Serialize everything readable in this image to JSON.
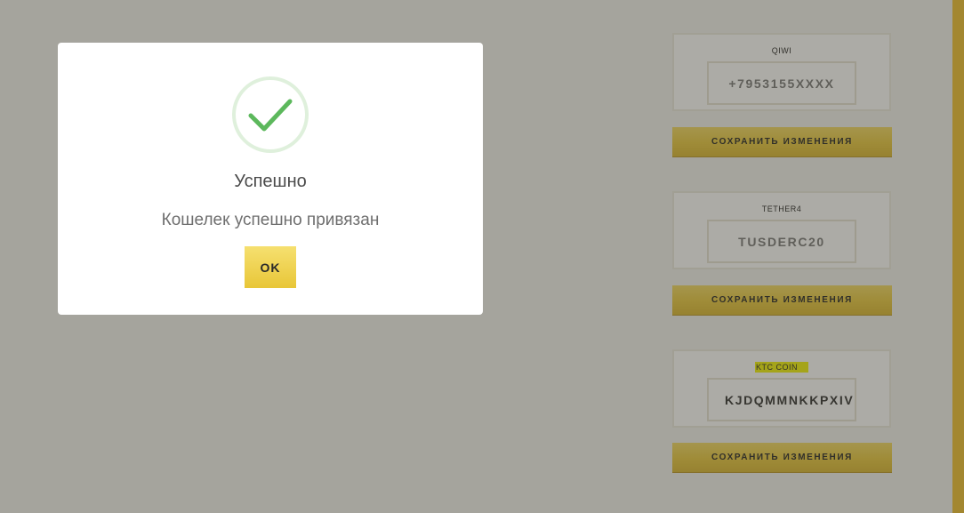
{
  "wallets": [
    {
      "name": "QIWI",
      "placeholder": "+7953155XXXX",
      "value": "",
      "highlighted": false
    },
    {
      "name": "TETHER4",
      "placeholder": "TUSDERC20",
      "value": "",
      "highlighted": false
    },
    {
      "name": "KTC COIN",
      "placeholder": "",
      "value": "KJDQMMNKKPXIV",
      "highlighted": true
    }
  ],
  "save_button_label": "СОХРАНИТЬ ИЗМЕНЕНИЯ",
  "modal": {
    "icon": "checkmark-icon",
    "title": "Успешно",
    "text": "Кошелек успешно привязан",
    "ok_label": "OK"
  },
  "colors": {
    "accent": "#e8c637",
    "success": "#5cb85c",
    "highlight": "#f3f200"
  }
}
